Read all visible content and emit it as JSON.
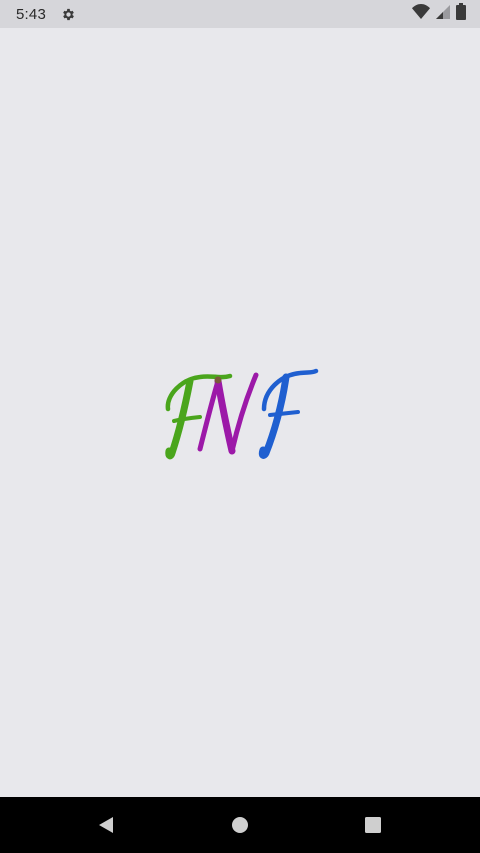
{
  "status_bar": {
    "time": "5:43",
    "icons": [
      "settings-icon",
      "wifi-icon",
      "cellular-signal-icon",
      "battery-icon"
    ]
  },
  "splash": {
    "logo_text": "FNF",
    "logo_letters": [
      {
        "char": "F",
        "color": "#4aa51c"
      },
      {
        "char": "N",
        "color": "#9c19a8"
      },
      {
        "char": "F",
        "color": "#1f5fd0"
      }
    ]
  },
  "nav_bar": {
    "buttons": [
      "back-icon",
      "home-icon",
      "recents-icon"
    ]
  },
  "colors": {
    "background": "#e8e8ec",
    "status_bar": "#d6d6da",
    "nav_bar": "#000000"
  }
}
